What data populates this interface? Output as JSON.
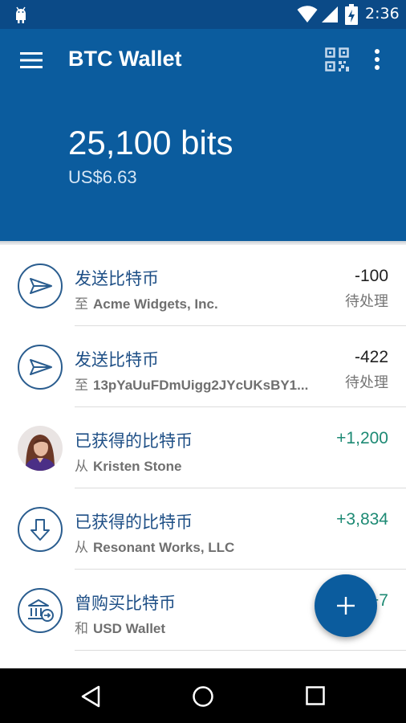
{
  "status_bar": {
    "time": "2:36",
    "icons": [
      "android-icon",
      "wifi-icon",
      "signal-icon",
      "battery-charging-icon"
    ]
  },
  "header": {
    "title": "BTC Wallet",
    "balance": "25,100 bits",
    "fiat_balance": "US$6.63",
    "icons": [
      "menu-icon",
      "qr-code-icon",
      "overflow-menu-icon"
    ],
    "background_color": "#0b5c9e"
  },
  "transactions": [
    {
      "icon": "send-icon",
      "title": "发送比特币",
      "prefix": "至",
      "party": "Acme Widgets, Inc.",
      "amount": "-100",
      "status": "待处理"
    },
    {
      "icon": "send-icon",
      "title": "发送比特币",
      "prefix": "至",
      "party": "13pYaUuFDmUigg2JYcUKsBY1...",
      "amount": "-422",
      "status": "待处理"
    },
    {
      "icon": "avatar",
      "title": "已获得的比特币",
      "prefix": "从",
      "party": "Kristen Stone",
      "amount": "+1,200",
      "status": ""
    },
    {
      "icon": "receive-icon",
      "title": "已获得的比特币",
      "prefix": "从",
      "party": "Resonant Works, LLC",
      "amount": "+3,834",
      "status": ""
    },
    {
      "icon": "bank-transfer-icon",
      "title": "曾购买比特币",
      "prefix": "和",
      "party": "USD Wallet",
      "amount": "+7",
      "status": ""
    }
  ],
  "fab": {
    "icon": "plus-icon",
    "color": "#0b5c9e"
  },
  "nav_bar": {
    "icons": [
      "back-icon",
      "home-icon",
      "recents-icon"
    ]
  },
  "colors": {
    "accent": "#0b5c9e",
    "positive": "#1d8a74",
    "title_text": "#1e4f86"
  }
}
